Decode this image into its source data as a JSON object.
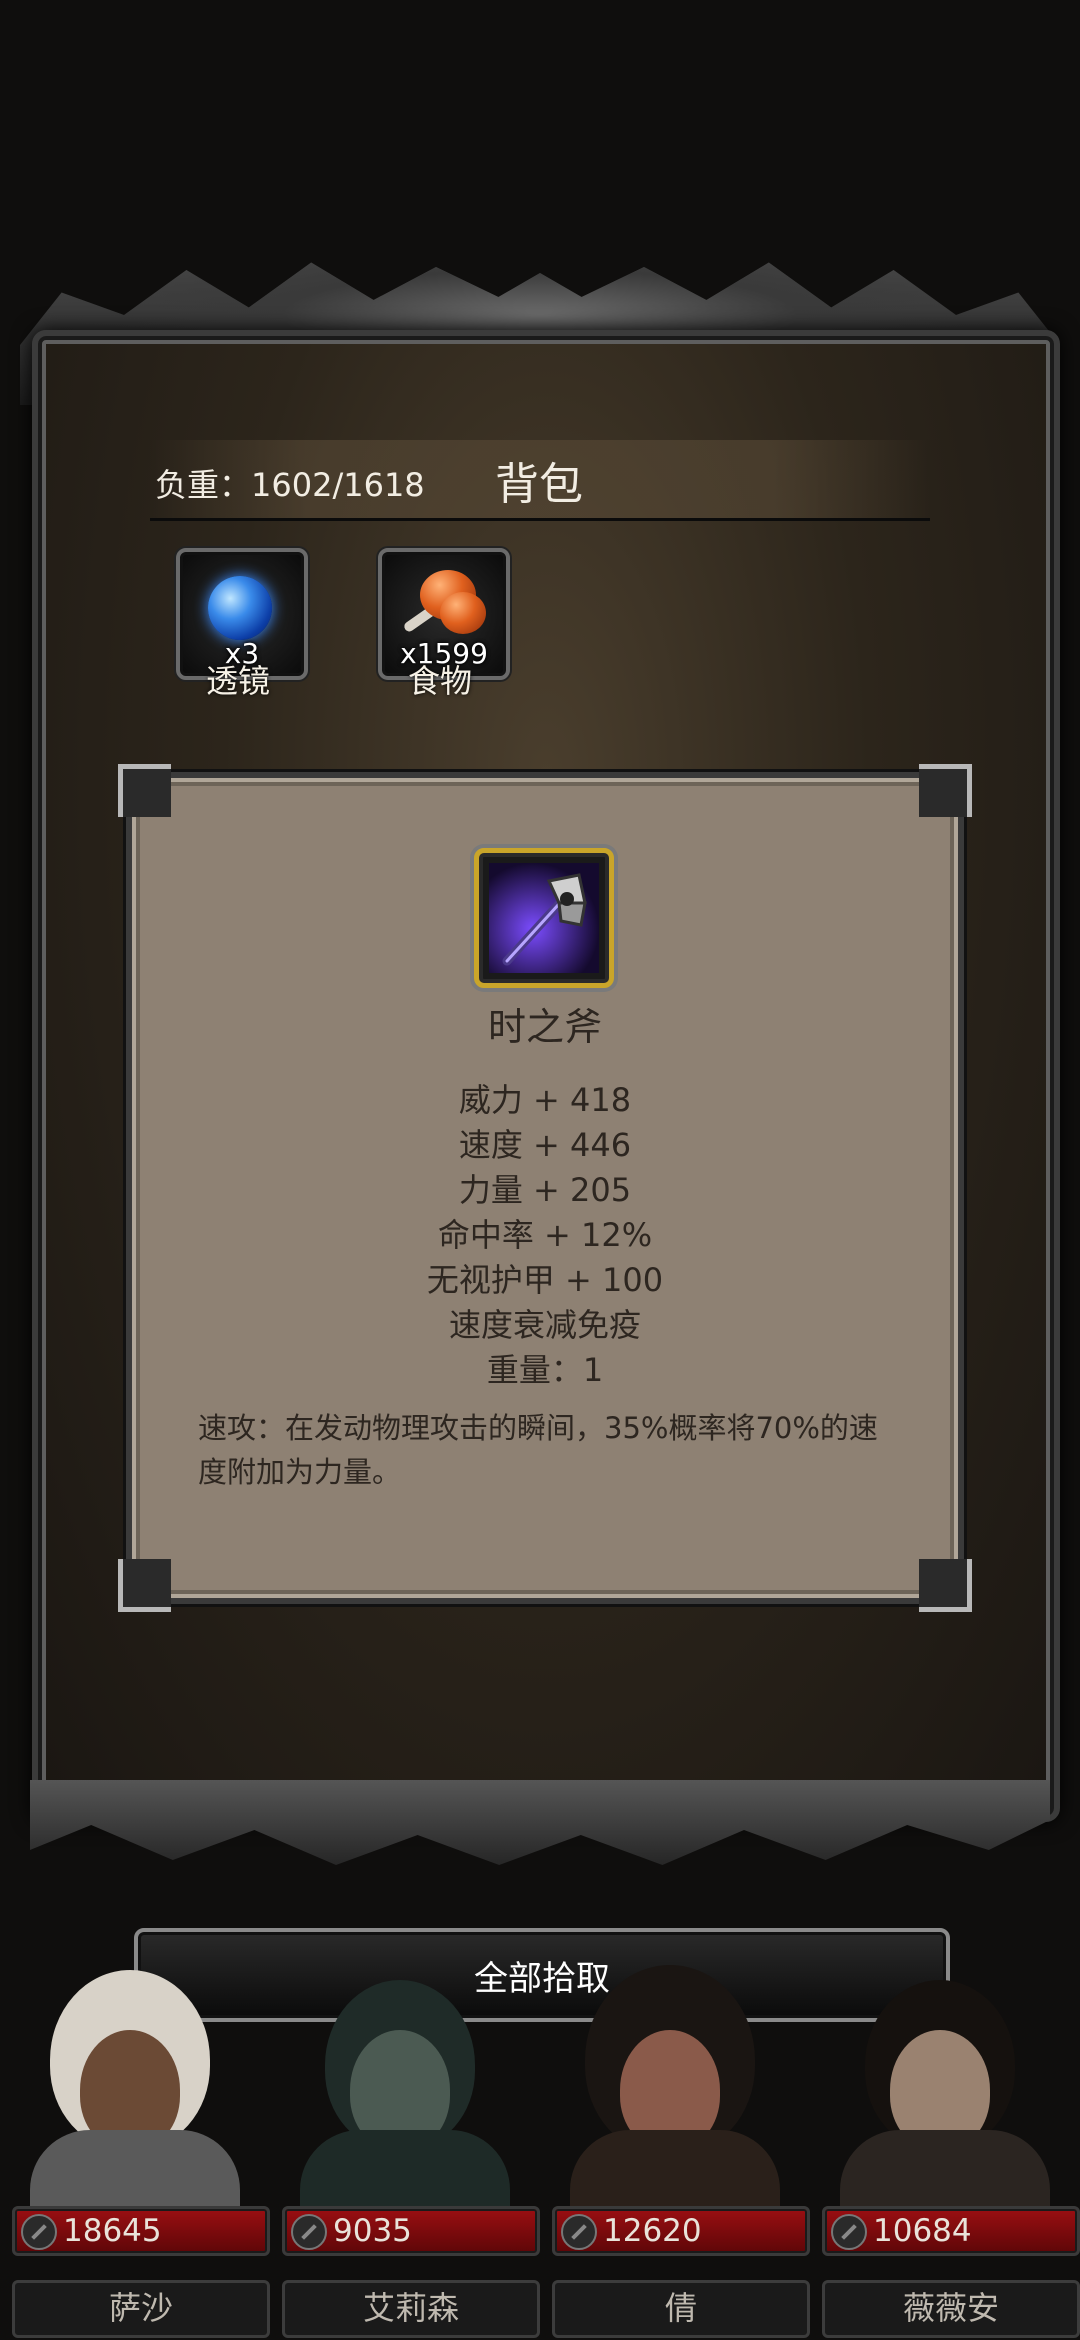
{
  "panel": {
    "weight_text": "负重：1602/1618",
    "title": "背包"
  },
  "inventory": [
    {
      "name": "透镜",
      "count": "x3",
      "icon": "blue-lens-orb-icon"
    },
    {
      "name": "食物",
      "count": "x1599",
      "icon": "meat-food-icon"
    }
  ],
  "detail": {
    "item_name": "时之斧",
    "icon": "axe-icon",
    "stats": [
      "威力 + 418",
      "速度 + 446",
      "力量 + 205",
      "命中率 + 12%",
      "无视护甲 + 100",
      "速度衰减免疫",
      "重量：1"
    ],
    "description": "速攻：在发动物理攻击的瞬间，35%概率将70%的速度附加为力量。"
  },
  "loot_all_label": "全部拾取",
  "party": [
    {
      "name": "萨沙",
      "hp": "18645"
    },
    {
      "name": "艾莉森",
      "hp": "9035"
    },
    {
      "name": "倩",
      "hp": "12620"
    },
    {
      "name": "薇薇安",
      "hp": "10684"
    }
  ],
  "colors": {
    "card_bg": "#8e8173",
    "hp_bar": "#9a0f12",
    "item_border_gold": "#c9a52a"
  }
}
